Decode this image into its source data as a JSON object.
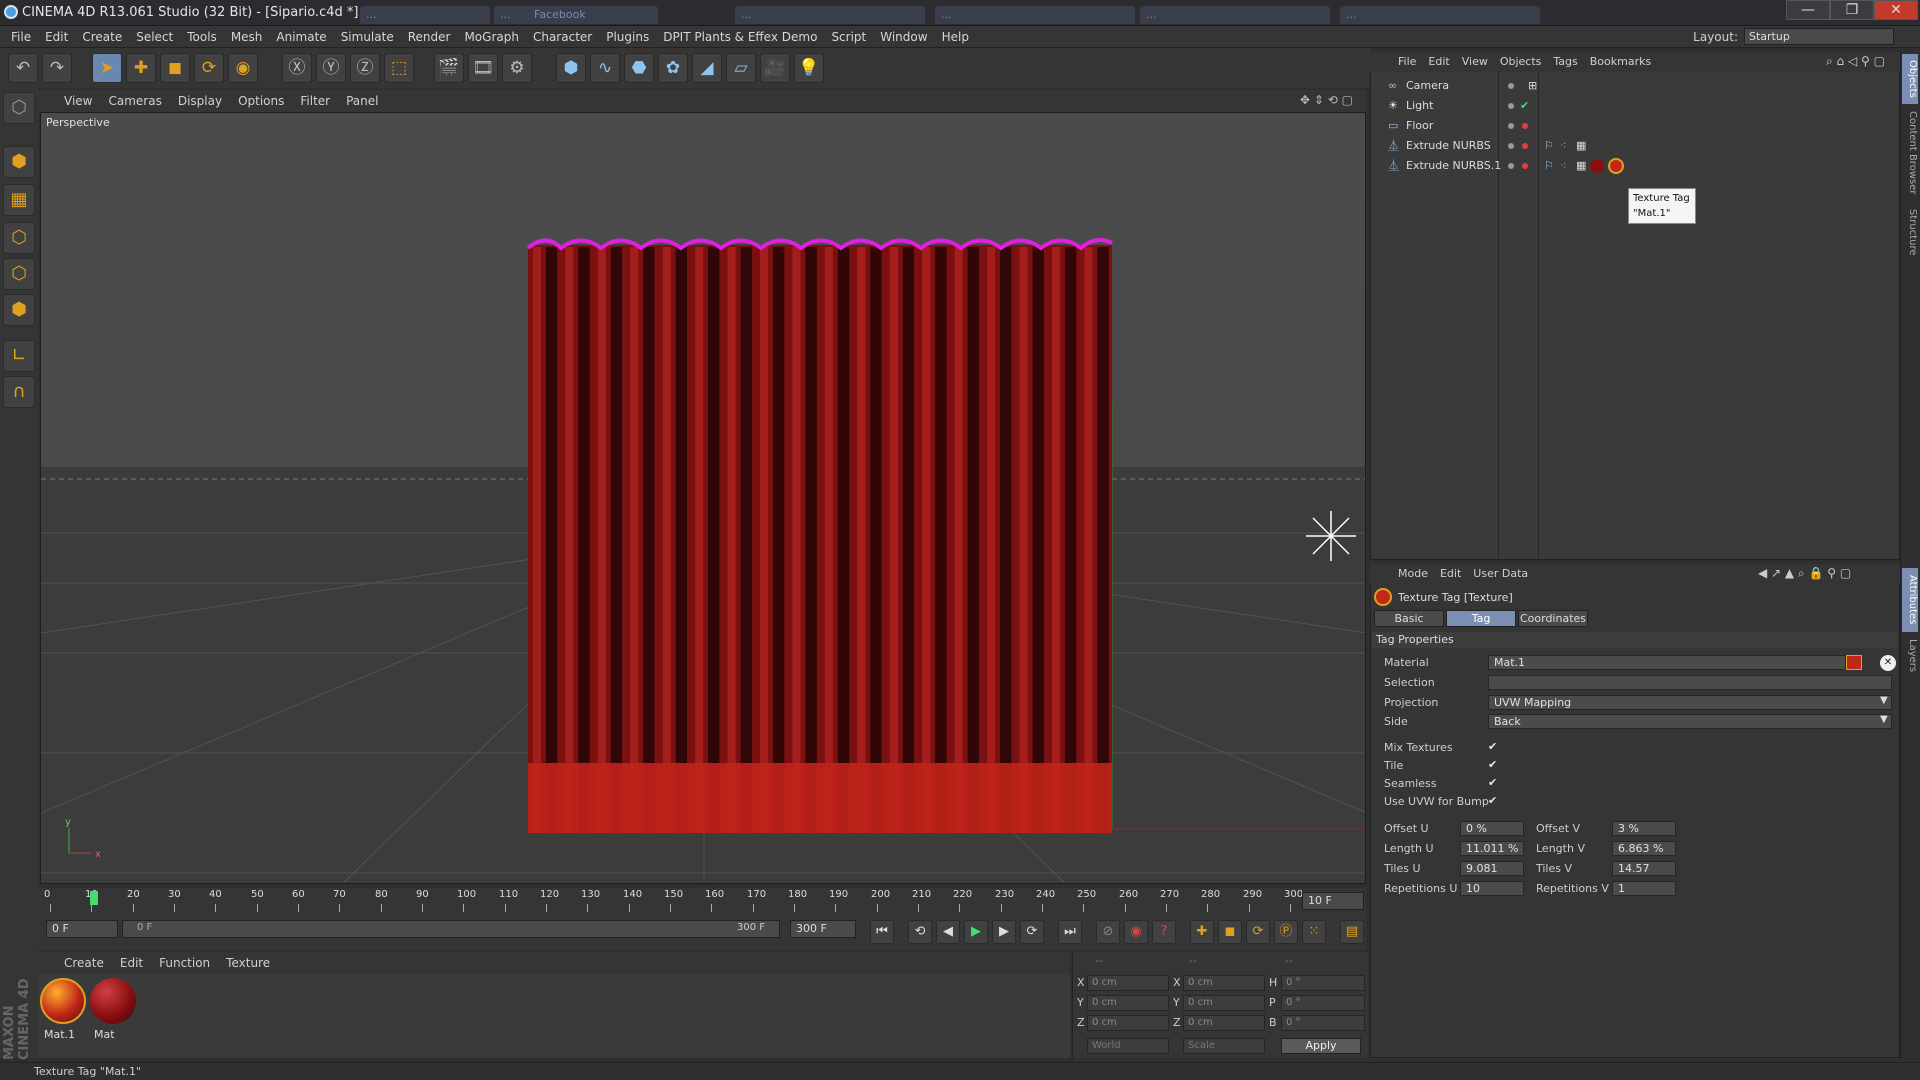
{
  "window": {
    "title": "CINEMA 4D R13.061 Studio (32 Bit) - [Sipario.c4d *]",
    "bg_tabs": [
      "...",
      "...",
      "Facebook",
      "...",
      "...",
      "...",
      "..."
    ],
    "minimize": "—",
    "maximize": "❐",
    "close": "✕"
  },
  "menubar": {
    "items": [
      "File",
      "Edit",
      "Create",
      "Select",
      "Tools",
      "Mesh",
      "Animate",
      "Simulate",
      "Render",
      "MoGraph",
      "Character",
      "Plugins",
      "DPIT Plants & Effex Demo",
      "Script",
      "Window",
      "Help"
    ],
    "layout_label": "Layout:",
    "layout_value": "Startup"
  },
  "viewport": {
    "menu": [
      "View",
      "Cameras",
      "Display",
      "Options",
      "Filter",
      "Panel"
    ],
    "label": "Perspective"
  },
  "timeline": {
    "ticks": [
      "0",
      "10",
      "20",
      "30",
      "40",
      "50",
      "60",
      "70",
      "80",
      "90",
      "100",
      "110",
      "120",
      "130",
      "140",
      "150",
      "160",
      "170",
      "180",
      "190",
      "200",
      "210",
      "220",
      "230",
      "240",
      "250",
      "260",
      "270",
      "280",
      "290",
      "300"
    ],
    "current_frame_field": "10 F",
    "start_field": "0 F",
    "range_start": "0 F",
    "range_end": "300 F",
    "end_field": "300 F"
  },
  "material_manager": {
    "menu": [
      "Create",
      "Edit",
      "Function",
      "Texture"
    ],
    "materials": [
      {
        "name": "Mat.1",
        "color": "#b0221a"
      },
      {
        "name": "Mat",
        "color": "#8a0f12"
      }
    ]
  },
  "coordinates": {
    "header": [
      "--",
      "--",
      "--"
    ],
    "rows": [
      {
        "a": "X",
        "av": "0 cm",
        "b": "X",
        "bv": "0 cm",
        "c": "H",
        "cv": "0 °"
      },
      {
        "a": "Y",
        "av": "0 cm",
        "b": "Y",
        "bv": "0 cm",
        "c": "P",
        "cv": "0 °"
      },
      {
        "a": "Z",
        "av": "0 cm",
        "b": "Z",
        "bv": "0 cm",
        "c": "B",
        "cv": "0 °"
      }
    ],
    "world": "World",
    "scale": "Scale",
    "apply": "Apply"
  },
  "object_manager": {
    "menu": [
      "File",
      "Edit",
      "View",
      "Objects",
      "Tags",
      "Bookmarks"
    ],
    "objects": [
      "Camera",
      "Light",
      "Floor",
      "Extrude NURBS",
      "Extrude NURBS.1"
    ],
    "tooltip_line1": "Texture Tag",
    "tooltip_line2": "\"Mat.1\""
  },
  "attributes": {
    "menu": [
      "Mode",
      "Edit",
      "User Data"
    ],
    "header": "Texture Tag [Texture]",
    "tabs": [
      "Basic",
      "Tag",
      "Coordinates"
    ],
    "section": "Tag Properties",
    "material_label": "Material",
    "material_value": "Mat.1",
    "selection_label": "Selection",
    "selection_value": "",
    "projection_label": "Projection",
    "projection_value": "UVW Mapping",
    "side_label": "Side",
    "side_value": "Back",
    "checks": [
      "Mix Textures",
      "Tile",
      "Seamless",
      "Use UVW for Bump"
    ],
    "offset_u_label": "Offset U",
    "offset_u": "0 %",
    "offset_v_label": "Offset V",
    "offset_v": "3 %",
    "length_u_label": "Length U",
    "length_u": "11.011 %",
    "length_v_label": "Length V",
    "length_v": "6.863 %",
    "tiles_u_label": "Tiles U",
    "tiles_u": "9.081",
    "tiles_v_label": "Tiles V",
    "tiles_v": "14.57",
    "rep_u_label": "Repetitions U",
    "rep_u": "10",
    "rep_v_label": "Repetitions V",
    "rep_v": "1"
  },
  "right_tabs": [
    "Objects",
    "Content Browser",
    "Structure",
    "Attributes",
    "Layers"
  ],
  "status": "Texture Tag \"Mat.1\"",
  "maxon": "MAXON CINEMA 4D",
  "colors": {
    "curtain": "#8c1414",
    "selection_edge": "#e020e0",
    "accent": "#7b8fb5"
  }
}
